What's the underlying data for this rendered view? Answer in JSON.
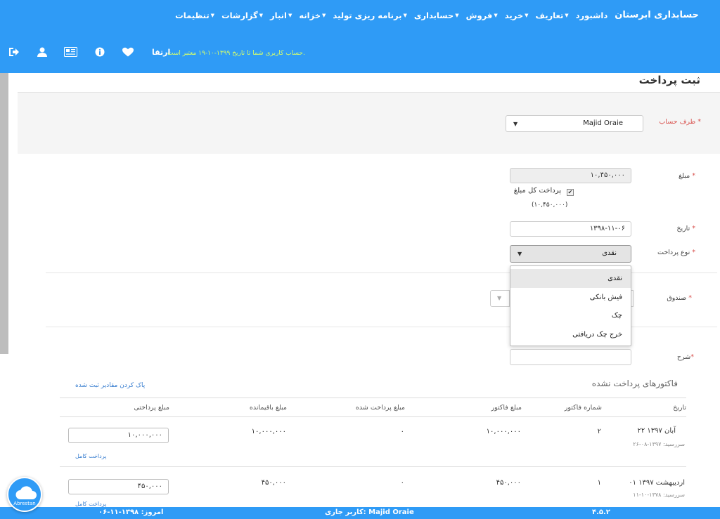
{
  "topnav": {
    "brand": "حسابداری ابرستان",
    "items": [
      "داشبورد",
      "تعاریف",
      "خرید",
      "فروش",
      "حسابداری",
      "برنامه ریزی تولید",
      "خزانه",
      "انبار",
      "گزارشات",
      "تنظیمات"
    ],
    "brand_sub": "ارتقا",
    "license_text": "حساب کاربری شما تا تاریخ ۱۳۹۹-۱۰-۱۹ معتبر است.",
    "icons": [
      "logout-icon",
      "user-icon",
      "news-icon",
      "info-icon",
      "heart-icon"
    ]
  },
  "page": {
    "title": "ثبت پرداخت"
  },
  "form": {
    "account_label": "طرف حساب",
    "account_value": "Majid Oraie",
    "amount_label": "مبلغ",
    "amount_value": "۱۰,۴۵۰,۰۰۰",
    "full_pay_label": "پرداخت کل مبلغ",
    "full_pay_amount": "(۱۰,۴۵۰,۰۰۰)",
    "full_pay_checked": true,
    "date_label": "تاریخ",
    "date_value": "۱۳۹۸-۱۱-۰۶",
    "payment_type_label": "نوع پرداخت",
    "payment_type_value": "نقدی",
    "payment_type_options": [
      "نقدی",
      "فیش بانکی",
      "چک",
      "خرج چک دریافتی"
    ],
    "box_label": "صندوق",
    "description_label": "شرح",
    "required_mark": "*"
  },
  "invoices": {
    "title": "فاکتورهای پرداخت نشده",
    "clear_link": "پاک کردن مقادیر ثبت شده",
    "headers": [
      "تاریخ",
      "شماره فاکتور",
      "مبلغ فاکتور",
      "مبلغ پرداخت شده",
      "مبلغ باقیمانده",
      "مبلغ پرداختی"
    ],
    "rows": [
      {
        "date": "۲۲ آبان ۱۳۹۷",
        "due": "سررسید: ۱۳۹۷-۰۸-۲۶",
        "number": "۲",
        "invoice_amount": "۱۰,۰۰۰,۰۰۰",
        "paid": "۰",
        "remaining": "۱۰,۰۰۰,۰۰۰",
        "payment": "۱۰,۰۰۰,۰۰۰",
        "pay_link": "پرداخت کامل"
      },
      {
        "date": "۰۱ اردیبهشت ۱۳۹۷",
        "due": "سررسید: ۱۳۷۸-۱۰-۱۱",
        "number": "۱",
        "invoice_amount": "۴۵۰,۰۰۰",
        "paid": "۰",
        "remaining": "۴۵۰,۰۰۰",
        "payment": "۴۵۰,۰۰۰",
        "pay_link": "پرداخت کامل"
      }
    ]
  },
  "footer": {
    "version": "۴.۵.۲",
    "current_user": "کاربر جاری: Majid Oraie",
    "today": "امروز: ۱۳۹۸-۱۱-۰۶"
  },
  "cloud_badge": {
    "label": "Abrestan"
  },
  "colors": {
    "primary": "#2f9bf6",
    "license_text": "#d7ff6a",
    "required": "#d9534f",
    "link": "#3a7fd0"
  }
}
